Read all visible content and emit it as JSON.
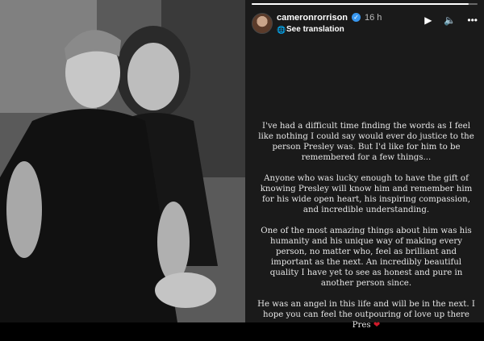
{
  "story": {
    "username": "cameronrorrison",
    "time": "16 h",
    "see_translation": "See translation",
    "progress_fraction": 0.96,
    "paragraphs": [
      "I've had a difficult time finding the words as I feel like nothing I could say would ever do justice to the person Presley was. But I'd like for him to be remembered for a few things...",
      "Anyone who was lucky enough to have the gift of knowing Presley will know him and remember him for his wide open heart, his inspiring compassion, and incredible understanding.",
      "One of the most amazing things about him was his humanity and his unique way of making every person, no matter who, feel as brilliant and important as the next. An incredibly beautiful quality I have yet to see as honest and pure in another person since.",
      "He was an angel in this life and will be in the next. I hope you can feel the outpouring of love up there Pres"
    ],
    "heart": "❤"
  },
  "icons": {
    "verified": "verified-badge",
    "translate": "globe-icon",
    "play": "play-icon",
    "mute": "speaker-icon",
    "more": "more-icon"
  }
}
